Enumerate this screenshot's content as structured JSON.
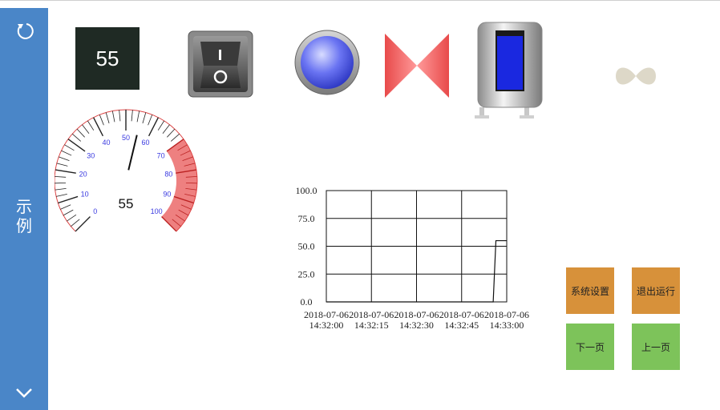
{
  "sidebar": {
    "title_chars": [
      "示",
      "例"
    ],
    "refresh_icon": "refresh-icon",
    "down_icon": "chevron-down-icon",
    "color": "#4a86c8"
  },
  "numeric_display": {
    "value": "55"
  },
  "gauge": {
    "value": "55",
    "labels": [
      "0",
      "10",
      "20",
      "30",
      "40",
      "50",
      "60",
      "70",
      "80",
      "90",
      "100"
    ],
    "min": 0,
    "max": 100,
    "alarm_from": 70
  },
  "chart_data": {
    "type": "line",
    "x": [
      "2018-07-06 14:32:00",
      "2018-07-06 14:32:15",
      "2018-07-06 14:32:30",
      "2018-07-06 14:32:45",
      "2018-07-06 14:33:00"
    ],
    "xtick_lines": [
      [
        "2018-07-06",
        "14:32:00"
      ],
      [
        "2018-07-06",
        "14:32:15"
      ],
      [
        "2018-07-06",
        "14:32:30"
      ],
      [
        "2018-07-06",
        "14:32:45"
      ],
      [
        "2018-07-06",
        "14:33:00"
      ]
    ],
    "yticks": [
      "100.0",
      "75.0",
      "50.0",
      "25.0",
      "0.0"
    ],
    "ylim": [
      0,
      100
    ],
    "series": [
      {
        "points": [
          [
            0,
            0
          ],
          [
            0.925,
            0
          ],
          [
            0.94,
            55
          ],
          [
            1,
            55
          ]
        ]
      }
    ],
    "grid": true
  },
  "buttons": {
    "system_settings": "系统设置",
    "exit_run": "退出运行",
    "next_page": "下一页",
    "prev_page": "上一页"
  }
}
